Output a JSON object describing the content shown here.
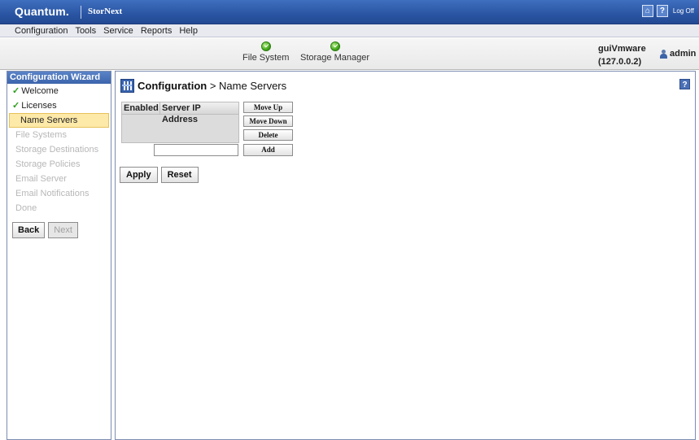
{
  "app": {
    "brand": "Quantum.",
    "product": "StorNext",
    "logoff_label": "Log Off"
  },
  "menu": [
    "Configuration",
    "Tools",
    "Service",
    "Reports",
    "Help"
  ],
  "status": [
    {
      "label": "File System",
      "state": "ok"
    },
    {
      "label": "Storage Manager",
      "state": "ok"
    }
  ],
  "host": {
    "name": "guiVmware",
    "ip": "(127.0.0.2)"
  },
  "user": {
    "name": "admin"
  },
  "sidebar": {
    "title": "Configuration Wizard",
    "items": [
      {
        "label": "Welcome",
        "state": "done"
      },
      {
        "label": "Licenses",
        "state": "done"
      },
      {
        "label": "Name Servers",
        "state": "current"
      },
      {
        "label": "File Systems",
        "state": "disabled"
      },
      {
        "label": "Storage Destinations",
        "state": "disabled"
      },
      {
        "label": "Storage Policies",
        "state": "disabled"
      },
      {
        "label": "Email Server",
        "state": "disabled"
      },
      {
        "label": "Email Notifications",
        "state": "disabled"
      },
      {
        "label": "Done",
        "state": "disabled"
      }
    ],
    "back_label": "Back",
    "next_label": "Next"
  },
  "page": {
    "section": "Configuration",
    "separator": " > ",
    "title": "Name Servers",
    "help": "?"
  },
  "table": {
    "columns": [
      "Enabled",
      "Server IP Address"
    ],
    "rows": []
  },
  "buttons": {
    "move_up": "Move Up",
    "move_down": "Move Down",
    "delete": "Delete",
    "add": "Add",
    "apply": "Apply",
    "reset": "Reset"
  },
  "ip_input": {
    "value": "",
    "placeholder": ""
  },
  "colors": {
    "accent": "#2a55a3",
    "ok": "#42a81b",
    "current_highlight": "#fde9a8"
  }
}
